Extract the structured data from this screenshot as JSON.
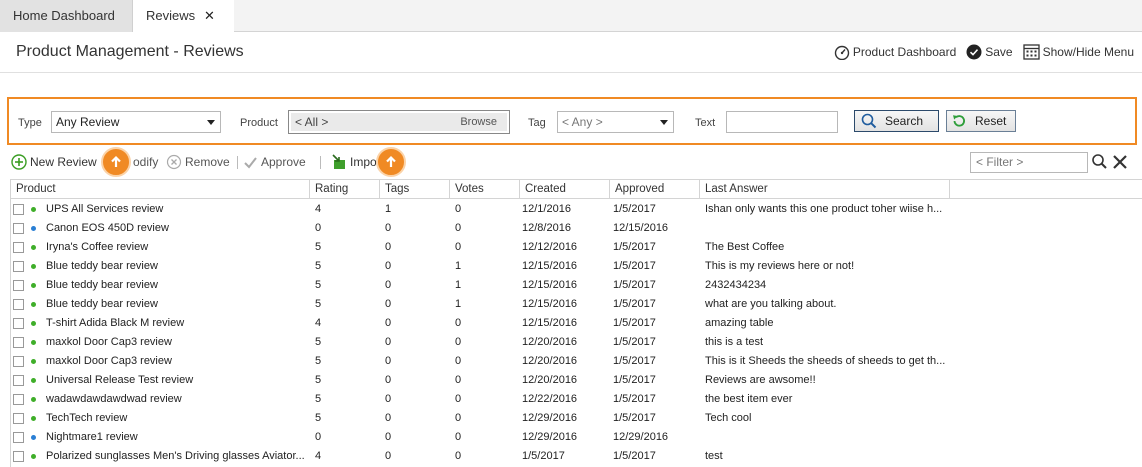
{
  "tabs": [
    {
      "label": "Home Dashboard"
    },
    {
      "label": "Reviews",
      "close": "✕"
    }
  ],
  "header": {
    "title": "Product Management - Reviews",
    "actions": {
      "dashboard": "Product Dashboard",
      "save": "Save",
      "menu": "Show/Hide Menu"
    }
  },
  "filters": {
    "type_label": "Type",
    "type_value": "Any Review",
    "product_label": "Product",
    "product_value": "< All >",
    "browse": "Browse",
    "tag_label": "Tag",
    "tag_value": "< Any >",
    "text_label": "Text",
    "text_value": "",
    "search": "Search",
    "reset": "Reset"
  },
  "toolbar": {
    "new_review": "New Review",
    "modify": "odify",
    "remove": "Remove",
    "approve": "Approve",
    "import": "Impo",
    "filter_placeholder": "< Filter >"
  },
  "colors": {
    "accent": "#f08a24",
    "dot_green": "#3fae29",
    "dot_blue": "#2a7fd4"
  },
  "table": {
    "columns": [
      "Product",
      "Rating",
      "Tags",
      "Votes",
      "Created",
      "Approved",
      "Last Answer"
    ],
    "rows": [
      {
        "status": "green",
        "product": "UPS All Services review",
        "rating": "4",
        "tags": "1",
        "votes": "0",
        "created": "12/1/2016",
        "approved": "1/5/2017",
        "last_answer": "Ishan only wants this one product toher wiise h..."
      },
      {
        "status": "blue",
        "product": "Canon EOS 450D review",
        "rating": "0",
        "tags": "0",
        "votes": "0",
        "created": "12/8/2016",
        "approved": "12/15/2016",
        "last_answer": ""
      },
      {
        "status": "green",
        "product": "Iryna's Coffee review",
        "rating": "5",
        "tags": "0",
        "votes": "0",
        "created": "12/12/2016",
        "approved": "1/5/2017",
        "last_answer": "The Best Coffee"
      },
      {
        "status": "green",
        "product": "Blue teddy bear review",
        "rating": "5",
        "tags": "0",
        "votes": "1",
        "created": "12/15/2016",
        "approved": "1/5/2017",
        "last_answer": "This is my reviews here or not!"
      },
      {
        "status": "green",
        "product": "Blue teddy bear review",
        "rating": "5",
        "tags": "0",
        "votes": "1",
        "created": "12/15/2016",
        "approved": "1/5/2017",
        "last_answer": "2432434234"
      },
      {
        "status": "green",
        "product": "Blue teddy bear review",
        "rating": "5",
        "tags": "0",
        "votes": "1",
        "created": "12/15/2016",
        "approved": "1/5/2017",
        "last_answer": "what are you talking about."
      },
      {
        "status": "green",
        "product": "T-shirt Adida Black M review",
        "rating": "4",
        "tags": "0",
        "votes": "0",
        "created": "12/15/2016",
        "approved": "1/5/2017",
        "last_answer": "amazing table"
      },
      {
        "status": "green",
        "product": "maxkol Door Cap3 review",
        "rating": "5",
        "tags": "0",
        "votes": "0",
        "created": "12/20/2016",
        "approved": "1/5/2017",
        "last_answer": "this is a test"
      },
      {
        "status": "green",
        "product": "maxkol Door Cap3 review",
        "rating": "5",
        "tags": "0",
        "votes": "0",
        "created": "12/20/2016",
        "approved": "1/5/2017",
        "last_answer": "This is it Sheeds the sheeds of sheeds to get th..."
      },
      {
        "status": "green",
        "product": "Universal Release Test review",
        "rating": "5",
        "tags": "0",
        "votes": "0",
        "created": "12/20/2016",
        "approved": "1/5/2017",
        "last_answer": "Reviews are awsome!!"
      },
      {
        "status": "green",
        "product": "wadawdawdawdwad review",
        "rating": "5",
        "tags": "0",
        "votes": "0",
        "created": "12/22/2016",
        "approved": "1/5/2017",
        "last_answer": "the best item ever"
      },
      {
        "status": "green",
        "product": "TechTech review",
        "rating": "5",
        "tags": "0",
        "votes": "0",
        "created": "12/29/2016",
        "approved": "1/5/2017",
        "last_answer": "Tech cool"
      },
      {
        "status": "blue",
        "product": "Nightmare1 review",
        "rating": "0",
        "tags": "0",
        "votes": "0",
        "created": "12/29/2016",
        "approved": "12/29/2016",
        "last_answer": ""
      },
      {
        "status": "green",
        "product": "Polarized sunglasses Men's Driving glasses Aviator...",
        "rating": "4",
        "tags": "0",
        "votes": "0",
        "created": "1/5/2017",
        "approved": "1/5/2017",
        "last_answer": "test"
      }
    ]
  }
}
